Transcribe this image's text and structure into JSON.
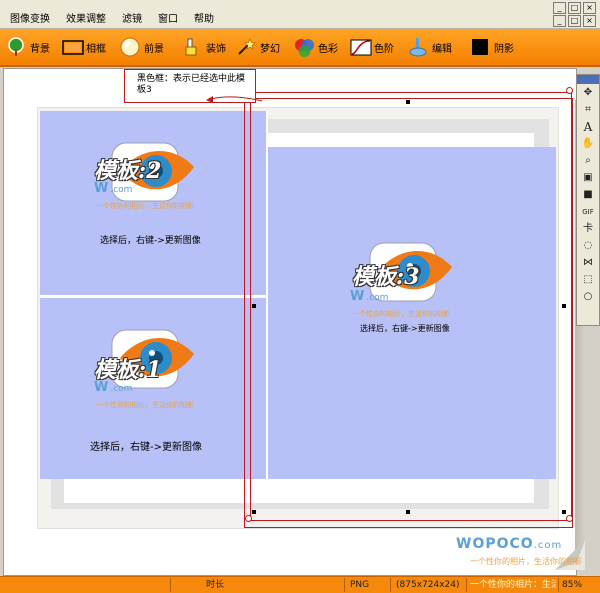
{
  "menu": {
    "items": [
      "图像变换",
      "效果调整",
      "滤镜",
      "窗口",
      "帮助"
    ]
  },
  "toolbar": {
    "tools": [
      {
        "label": "背景",
        "icon": "tree-icon"
      },
      {
        "label": "相框",
        "icon": "frame-icon"
      },
      {
        "label": "前景",
        "icon": "sphere-icon"
      },
      {
        "label": "装饰",
        "icon": "paint-bucket-icon"
      },
      {
        "label": "梦幻",
        "icon": "magic-wand-icon"
      },
      {
        "label": "色彩",
        "icon": "color-circles-icon"
      },
      {
        "label": "色阶",
        "icon": "curve-icon"
      },
      {
        "label": "编辑",
        "icon": "edit-hand-icon"
      },
      {
        "label": "阴影",
        "icon": "shadow-square-icon"
      }
    ]
  },
  "callout": {
    "text": "黑色框：表示已经选中此模板3"
  },
  "templates": {
    "t2": {
      "title": "模板:2",
      "brand": "W",
      "domain": ".com",
      "slogan": "一个性你的相片，生活你的相影",
      "hint": "选择后，右键->更新图像"
    },
    "t1": {
      "title": "模板:1",
      "brand": "W",
      "domain": ".com",
      "slogan": "一个性你的相片，生活你的相影",
      "hint": "选择后，右键->更新图像"
    },
    "t3": {
      "title": "模板:3",
      "brand": "W",
      "domain": ".com",
      "slogan": "一个性你的相片，生活你的相影",
      "hint": "选择后，右键->更新图像"
    }
  },
  "watermark": {
    "brand": "WOPOCO",
    "domain": ".com",
    "slogan": "一个性你的相片，生活你的相影"
  },
  "palette": {
    "tools": [
      {
        "icon": "move-icon",
        "glyph": "✥"
      },
      {
        "icon": "crop-icon",
        "glyph": "⌗"
      },
      {
        "icon": "text-icon",
        "glyph": "A"
      },
      {
        "icon": "hand-icon",
        "glyph": "✋"
      },
      {
        "icon": "zoom-icon",
        "glyph": "⌕"
      },
      {
        "icon": "image-icon",
        "glyph": "▣"
      },
      {
        "icon": "color-swatch-icon",
        "glyph": "■"
      },
      {
        "icon": "gif-icon",
        "glyph": "GIF"
      },
      {
        "icon": "card-icon",
        "glyph": "卡"
      },
      {
        "icon": "lasso-icon",
        "glyph": "◌"
      },
      {
        "icon": "polygon-lasso-icon",
        "glyph": "⋈"
      },
      {
        "icon": "rect-select-icon",
        "glyph": "⬚"
      },
      {
        "icon": "ellipse-select-icon",
        "glyph": "○"
      }
    ]
  },
  "status": {
    "duration_label": "时长",
    "format": "PNG",
    "dimensions": "(875x724x24)",
    "info": "一个性你的相片：生活你的相影。",
    "zoom": "85%"
  },
  "colors": {
    "toolbar": "#f47f00",
    "template_bg": "#b7c1f7",
    "selection": "#c21818"
  }
}
